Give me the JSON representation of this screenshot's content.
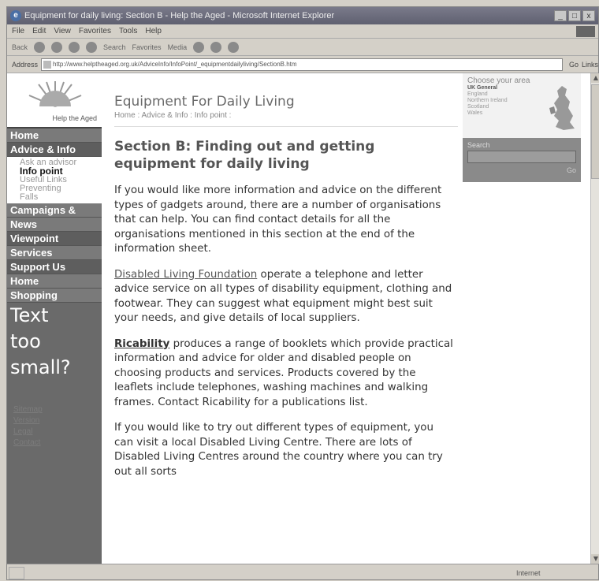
{
  "window": {
    "title": "Equipment for daily living: Section B - Help the Aged - Microsoft Internet Explorer",
    "min": "_",
    "max": "□",
    "close": "x"
  },
  "menu": [
    "File",
    "Edit",
    "View",
    "Favorites",
    "Tools",
    "Help"
  ],
  "toolbar": {
    "back": "Back",
    "search": "Search",
    "favorites": "Favorites",
    "media": "Media"
  },
  "address": {
    "label": "Address",
    "url": "http://www.helptheaged.org.uk/AdviceInfo/InfoPoint/_equipmentdailyliving/SectionB.htm",
    "go": "Go",
    "links": "Links"
  },
  "logo": {
    "brand": "Help the Aged"
  },
  "nav": {
    "home": "Home",
    "advice": "Advice & Info",
    "sub": [
      "Ask an advisor",
      "Info point",
      "Useful Links",
      "Preventing",
      "Falls"
    ],
    "campaigns": "Campaigns &",
    "news": "News",
    "viewpoint": "Viewpoint",
    "services": "Services",
    "support": "Support Us",
    "home_shopping_1": "Home",
    "home_shopping_2": "Shopping",
    "text_small": [
      "Text",
      "too",
      "small?"
    ],
    "links": [
      "Sitemap",
      "Version",
      "Legal",
      "Contact"
    ]
  },
  "content": {
    "heading": "Equipment For Daily Living",
    "breadcrumb": [
      "Home",
      "Advice & Info",
      "Info point"
    ],
    "section_title": "Section B: Finding out and getting equipment for daily living",
    "p1": "If you would like more information and advice on the different types of gadgets around, there are a number of organisations that can help. You can find contact details for all the organisations mentioned in this section at the end of the information sheet.",
    "p2_link": "Disabled Living Foundation",
    "p2_rest": " operate a telephone and letter advice service on all types of disability equipment, clothing and footwear. They can suggest what equipment might best suit your needs, and give details of local suppliers.",
    "p3_link": "Ricability",
    "p3_rest": " produces a range of booklets which provide practical information and advice for older and disabled people on choosing products and services. Products covered by the leaflets include telephones, washing machines and walking frames. Contact Ricability for a publications list.",
    "p4": "If you would like to try out different types of equipment, you can visit a local Disabled Living Centre. There are lots of Disabled Living Centres around the country where you can try out all sorts"
  },
  "right": {
    "choose_area": "Choose your area",
    "regions": [
      "UK General",
      "England",
      "Northern Ireland",
      "Scotland",
      "Wales"
    ],
    "search_label": "Search",
    "search_btn": "Go"
  },
  "status": {
    "zone": "Internet"
  }
}
